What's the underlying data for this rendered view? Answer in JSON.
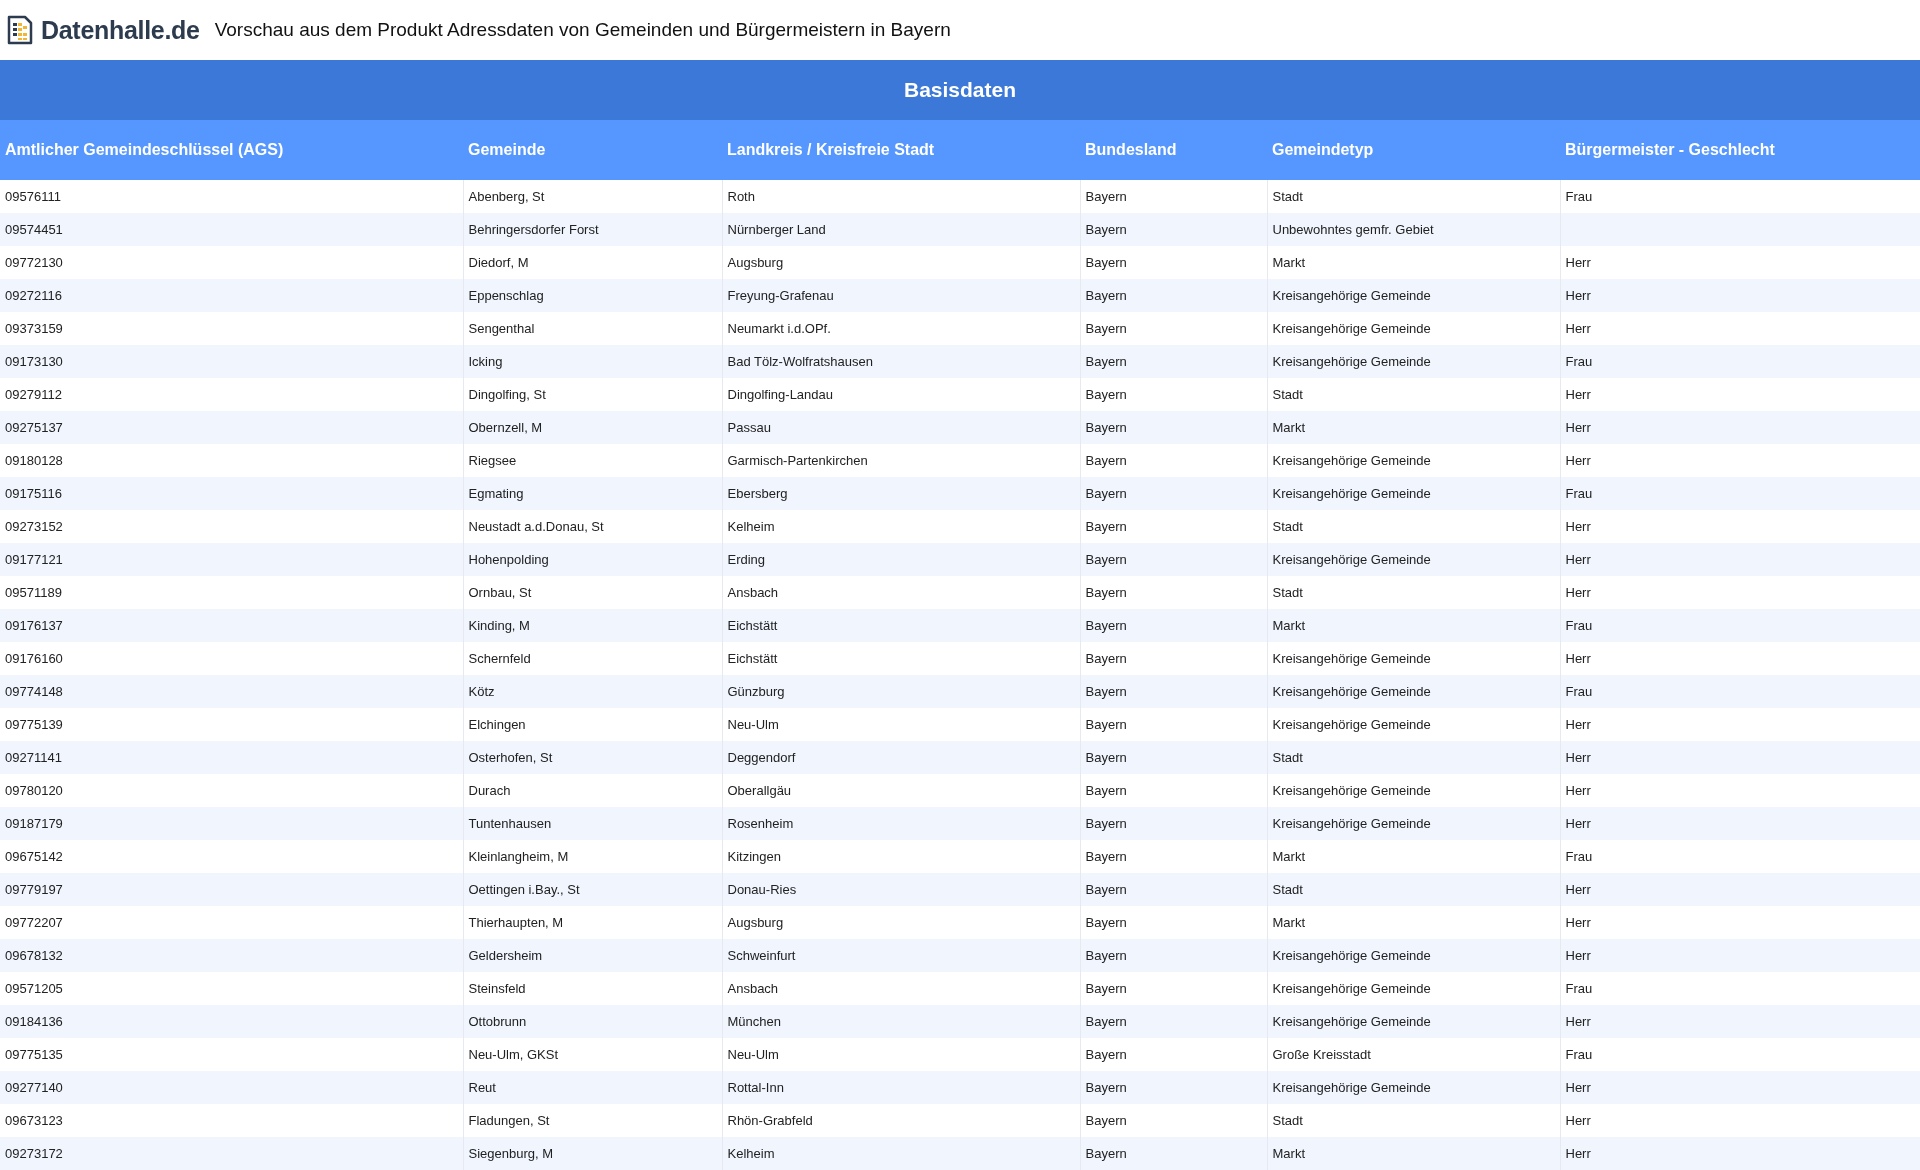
{
  "header": {
    "logo_text": "Datenhalle.de",
    "title": "Vorschau aus dem Produkt Adressdaten von Gemeinden und Bürgermeistern in Bayern"
  },
  "table": {
    "section_title": "Basisdaten",
    "columns": [
      "Amtlicher Gemeindeschlüssel (AGS)",
      "Gemeinde",
      "Landkreis / Kreisfreie Stadt",
      "Bundesland",
      "Gemeindetyp",
      "Bürgermeister - Geschlecht"
    ],
    "rows": [
      [
        "09576111",
        "Abenberg, St",
        "Roth",
        "Bayern",
        "Stadt",
        "Frau"
      ],
      [
        "09574451",
        "Behringersdorfer Forst",
        "Nürnberger Land",
        "Bayern",
        "Unbewohntes gemfr. Gebiet",
        ""
      ],
      [
        "09772130",
        "Diedorf, M",
        "Augsburg",
        "Bayern",
        "Markt",
        "Herr"
      ],
      [
        "09272116",
        "Eppenschlag",
        "Freyung-Grafenau",
        "Bayern",
        "Kreisangehörige Gemeinde",
        "Herr"
      ],
      [
        "09373159",
        "Sengenthal",
        "Neumarkt i.d.OPf.",
        "Bayern",
        "Kreisangehörige Gemeinde",
        "Herr"
      ],
      [
        "09173130",
        "Icking",
        "Bad Tölz-Wolfratshausen",
        "Bayern",
        "Kreisangehörige Gemeinde",
        "Frau"
      ],
      [
        "09279112",
        "Dingolfing, St",
        "Dingolfing-Landau",
        "Bayern",
        "Stadt",
        "Herr"
      ],
      [
        "09275137",
        "Obernzell, M",
        "Passau",
        "Bayern",
        "Markt",
        "Herr"
      ],
      [
        "09180128",
        "Riegsee",
        "Garmisch-Partenkirchen",
        "Bayern",
        "Kreisangehörige Gemeinde",
        "Herr"
      ],
      [
        "09175116",
        "Egmating",
        "Ebersberg",
        "Bayern",
        "Kreisangehörige Gemeinde",
        "Frau"
      ],
      [
        "09273152",
        "Neustadt a.d.Donau, St",
        "Kelheim",
        "Bayern",
        "Stadt",
        "Herr"
      ],
      [
        "09177121",
        "Hohenpolding",
        "Erding",
        "Bayern",
        "Kreisangehörige Gemeinde",
        "Herr"
      ],
      [
        "09571189",
        "Ornbau, St",
        "Ansbach",
        "Bayern",
        "Stadt",
        "Herr"
      ],
      [
        "09176137",
        "Kinding, M",
        "Eichstätt",
        "Bayern",
        "Markt",
        "Frau"
      ],
      [
        "09176160",
        "Schernfeld",
        "Eichstätt",
        "Bayern",
        "Kreisangehörige Gemeinde",
        "Herr"
      ],
      [
        "09774148",
        "Kötz",
        "Günzburg",
        "Bayern",
        "Kreisangehörige Gemeinde",
        "Frau"
      ],
      [
        "09775139",
        "Elchingen",
        "Neu-Ulm",
        "Bayern",
        "Kreisangehörige Gemeinde",
        "Herr"
      ],
      [
        "09271141",
        "Osterhofen, St",
        "Deggendorf",
        "Bayern",
        "Stadt",
        "Herr"
      ],
      [
        "09780120",
        "Durach",
        "Oberallgäu",
        "Bayern",
        "Kreisangehörige Gemeinde",
        "Herr"
      ],
      [
        "09187179",
        "Tuntenhausen",
        "Rosenheim",
        "Bayern",
        "Kreisangehörige Gemeinde",
        "Herr"
      ],
      [
        "09675142",
        "Kleinlangheim, M",
        "Kitzingen",
        "Bayern",
        "Markt",
        "Frau"
      ],
      [
        "09779197",
        "Oettingen i.Bay., St",
        "Donau-Ries",
        "Bayern",
        "Stadt",
        "Herr"
      ],
      [
        "09772207",
        "Thierhaupten, M",
        "Augsburg",
        "Bayern",
        "Markt",
        "Herr"
      ],
      [
        "09678132",
        "Geldersheim",
        "Schweinfurt",
        "Bayern",
        "Kreisangehörige Gemeinde",
        "Herr"
      ],
      [
        "09571205",
        "Steinsfeld",
        "Ansbach",
        "Bayern",
        "Kreisangehörige Gemeinde",
        "Frau"
      ],
      [
        "09184136",
        "Ottobrunn",
        "München",
        "Bayern",
        "Kreisangehörige Gemeinde",
        "Herr"
      ],
      [
        "09775135",
        "Neu-Ulm, GKSt",
        "Neu-Ulm",
        "Bayern",
        "Große Kreisstadt",
        "Frau"
      ],
      [
        "09277140",
        "Reut",
        "Rottal-Inn",
        "Bayern",
        "Kreisangehörige Gemeinde",
        "Herr"
      ],
      [
        "09673123",
        "Fladungen, St",
        "Rhön-Grabfeld",
        "Bayern",
        "Stadt",
        "Herr"
      ],
      [
        "09273172",
        "Siegenburg, M",
        "Kelheim",
        "Bayern",
        "Markt",
        "Herr"
      ]
    ]
  }
}
